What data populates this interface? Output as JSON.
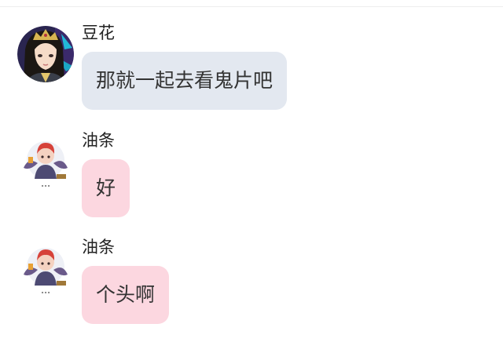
{
  "messages": [
    {
      "sender": "豆花",
      "text": "那就一起去看鬼片吧",
      "bubble_color": "#e3e8f0",
      "avatar_icon": "anime-character-avatar"
    },
    {
      "sender": "油条",
      "text": "好",
      "bubble_color": "#fcd7e0",
      "avatar_icon": "chibi-character-avatar"
    },
    {
      "sender": "油条",
      "text": "个头啊",
      "bubble_color": "#fcd7e0",
      "avatar_icon": "chibi-character-avatar"
    }
  ]
}
